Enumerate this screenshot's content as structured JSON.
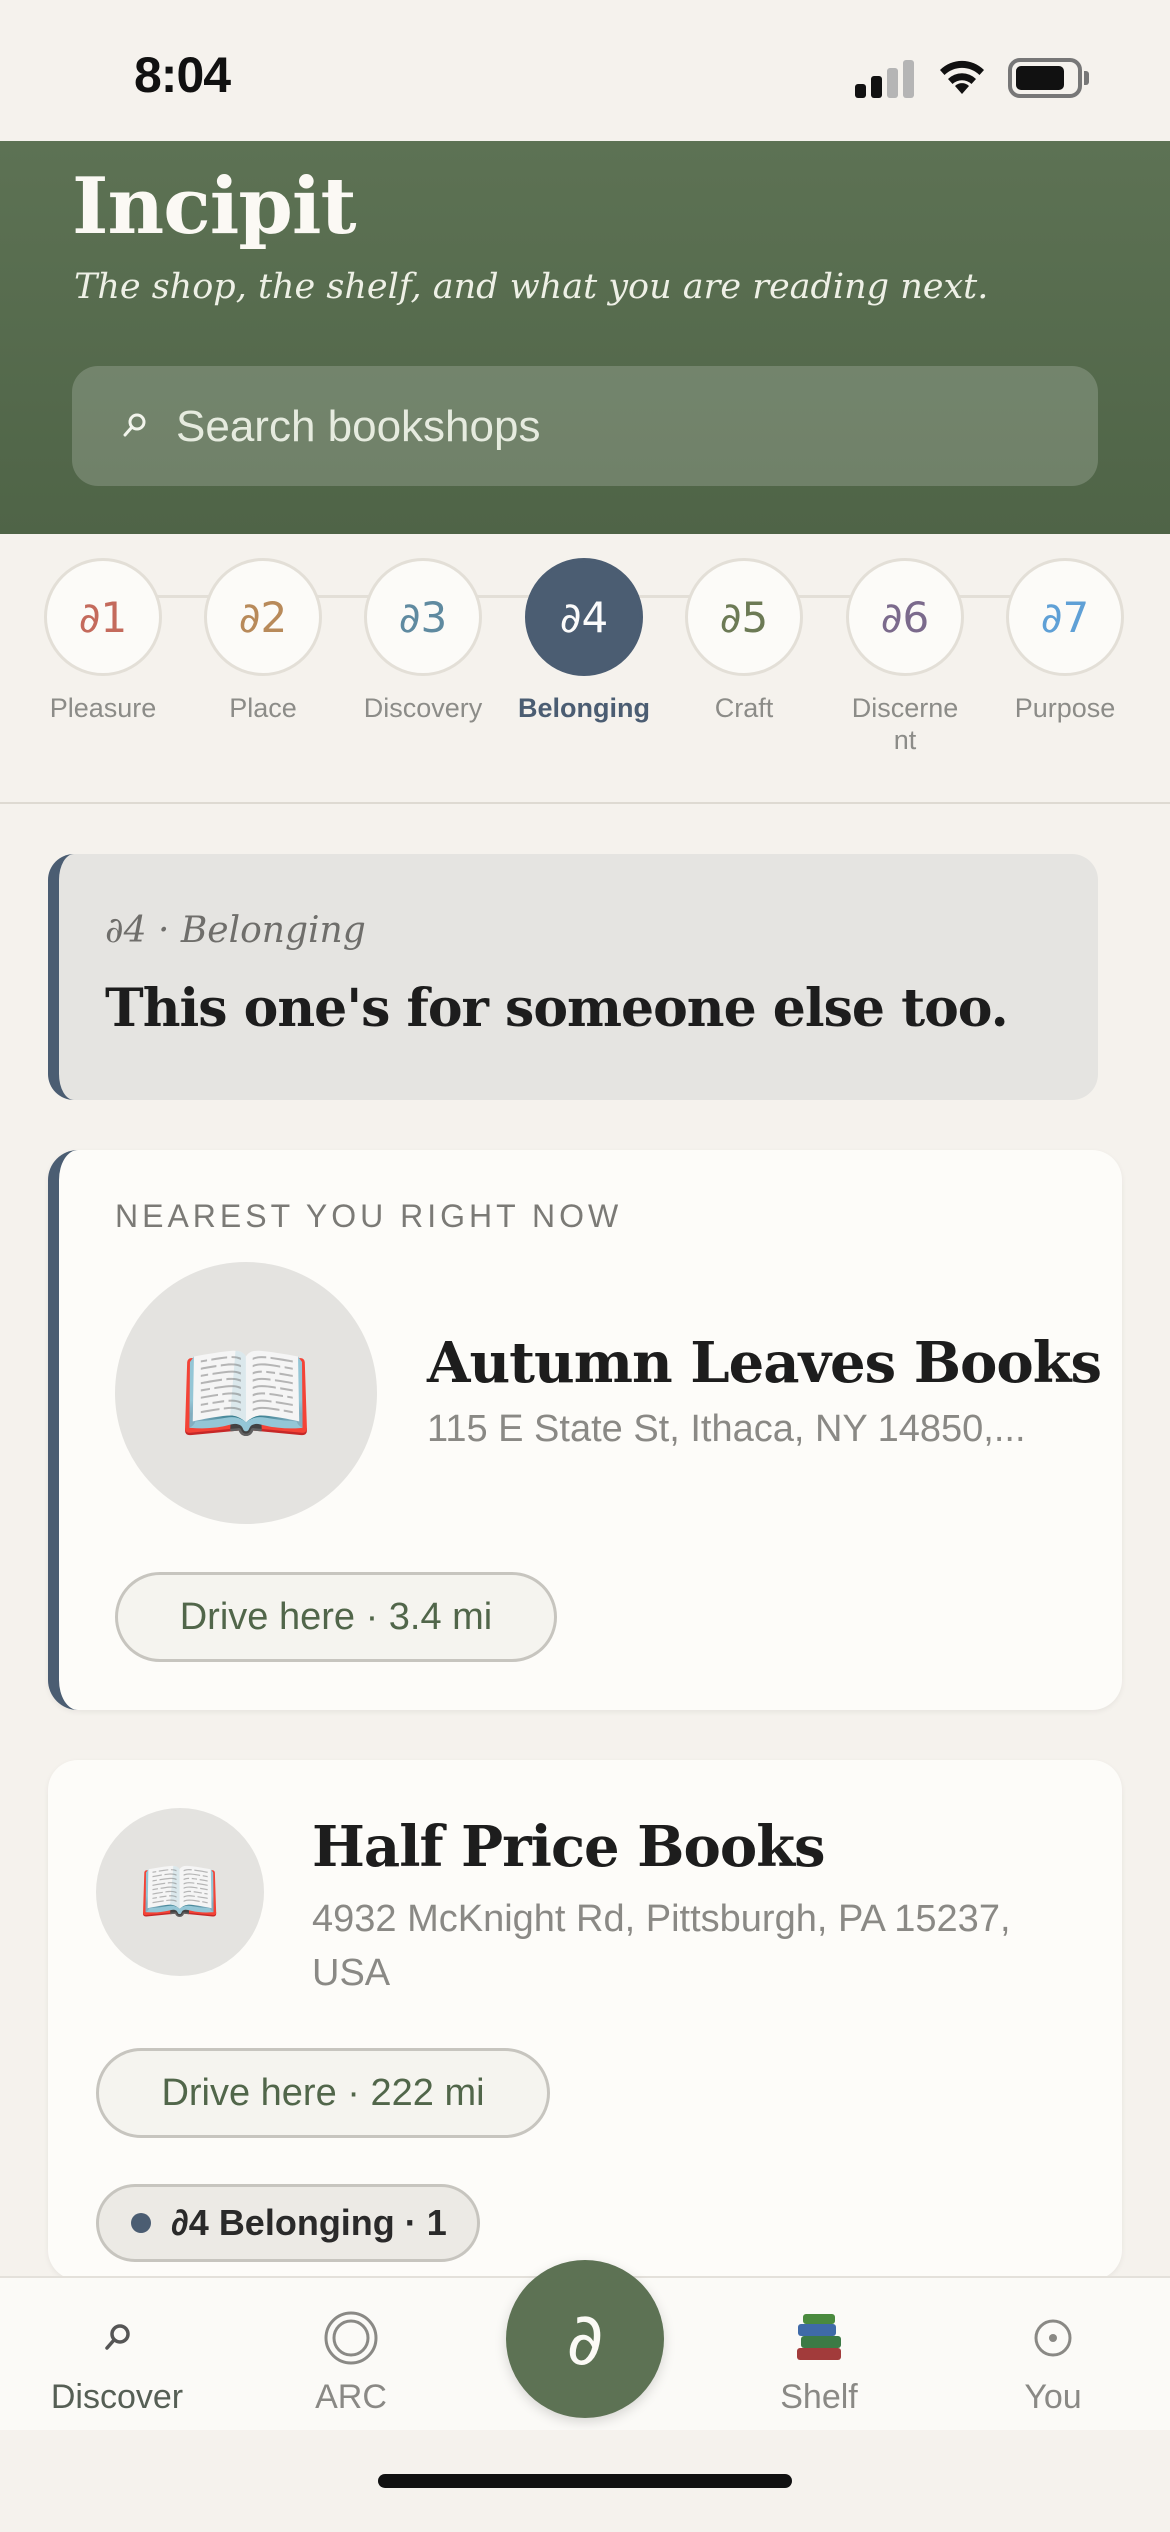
{
  "status_bar": {
    "time": "8:04"
  },
  "header": {
    "title": "Incipit",
    "tagline": "The shop, the shelf, and what you are reading next.",
    "search_placeholder": "Search bookshops"
  },
  "dimensions": [
    {
      "symbol": "∂1",
      "label": "Pleasure",
      "color": "#c46a5c"
    },
    {
      "symbol": "∂2",
      "label": "Place",
      "color": "#b88a5a"
    },
    {
      "symbol": "∂3",
      "label": "Discovery",
      "color": "#5f8aa0"
    },
    {
      "symbol": "∂4",
      "label": "Belonging",
      "color": "#4b5d72",
      "active": true
    },
    {
      "symbol": "∂5",
      "label": "Craft",
      "color": "#6c7a55"
    },
    {
      "symbol": "∂6",
      "label": "Discerne\nnt",
      "color": "#7b6a8c"
    },
    {
      "symbol": "∂7",
      "label": "Purpose",
      "color": "#5fa0d6"
    }
  ],
  "quote": {
    "kicker": "∂4 · Belonging",
    "text": "This one's for someone else too."
  },
  "nearest_card": {
    "kicker": "NEAREST YOU RIGHT NOW",
    "thumb_icon": "📖",
    "name": "Autumn Leaves Books",
    "address": "115 E State St, Ithaca, NY 14850,...",
    "drive_label": "Drive here · 3.4 mi"
  },
  "second_card": {
    "thumb_icon": "📖",
    "name": "Half Price Books",
    "address": "4932 McKnight Rd, Pittsburgh, PA 15237, USA",
    "drive_label": "Drive here · 222 mi",
    "tag_label": "∂4 Belonging · 1"
  },
  "tabbar": {
    "discover": "Discover",
    "arc": "ARC",
    "fab_symbol": "∂",
    "shelf": "Shelf",
    "you": "You"
  },
  "colors": {
    "header_green": "#5d7254",
    "accent_slate": "#4b5d72",
    "background": "#f5f2ed"
  }
}
